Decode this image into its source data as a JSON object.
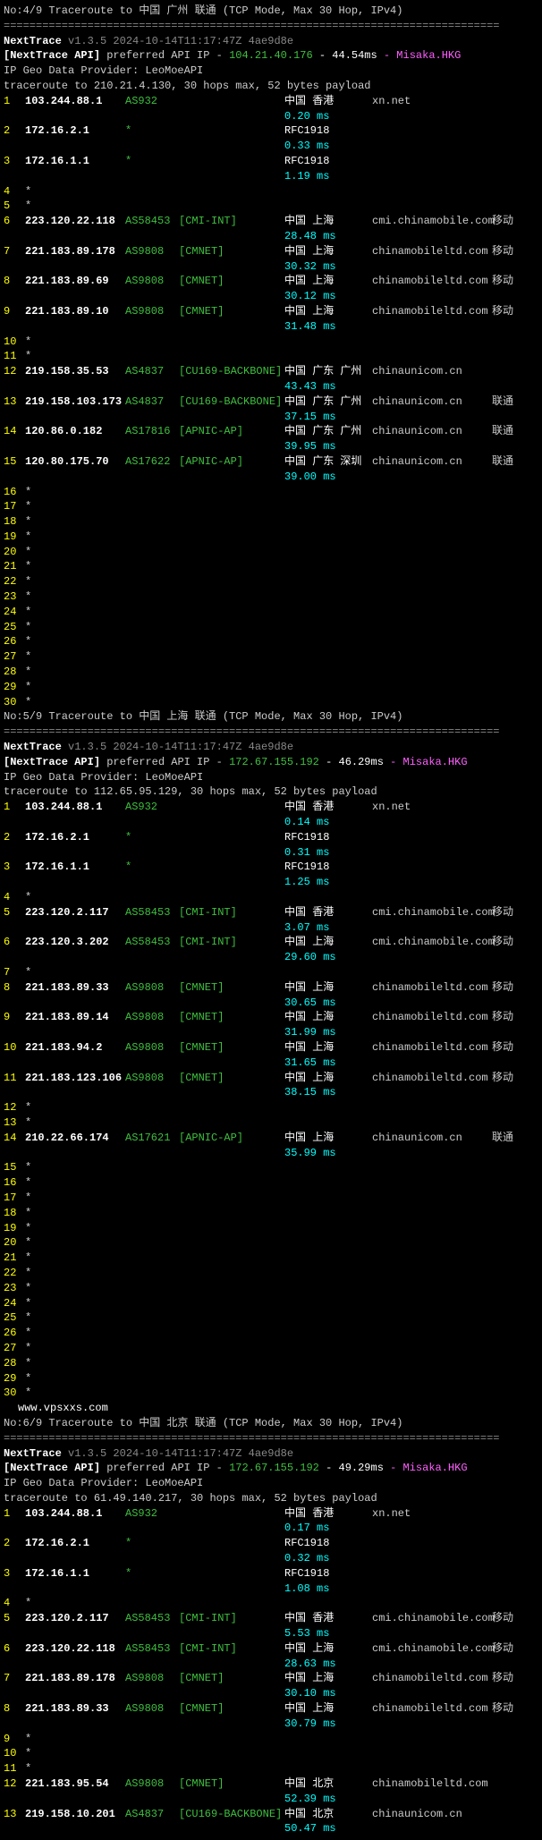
{
  "sections": [
    {
      "header": "No:4/9 Traceroute to 中国 广州 联通 (TCP Mode, Max 30 Hop, IPv4)",
      "nexttrace": "NextTrace",
      "version": "v1.3.5 2024-10-14T11:17:47Z 4ae9d8e",
      "api_label": "[NextTrace API]",
      "api_text": "preferred API IP -",
      "api_ip": "104.21.40.176",
      "api_ms": "- 44.54ms",
      "api_loc": "- Misaka.HKG",
      "geo": "IP Geo Data Provider: LeoMoeAPI",
      "trace": "traceroute to 210.21.4.130, 30 hops max, 52 bytes payload",
      "hops": [
        {
          "n": "1",
          "ip": "103.244.88.1",
          "asn": "AS932",
          "net": "",
          "geo": "中国 香港",
          "host": "xn.net",
          "isp": "",
          "ms": "0.20 ms"
        },
        {
          "n": "2",
          "ip": "172.16.2.1",
          "asn": "*",
          "net": "",
          "geo": "",
          "rfc": "RFC1918",
          "host": "",
          "isp": "",
          "ms": "0.33 ms"
        },
        {
          "n": "3",
          "ip": "172.16.1.1",
          "asn": "*",
          "net": "",
          "geo": "",
          "rfc": "RFC1918",
          "host": "",
          "isp": "",
          "ms": "1.19 ms"
        },
        {
          "n": "4",
          "star": true
        },
        {
          "n": "5",
          "star": true
        },
        {
          "n": "6",
          "ip": "223.120.22.118",
          "asn": "AS58453",
          "net": "[CMI-INT]",
          "geo": "中国 上海",
          "host": "cmi.chinamobile.com",
          "isp": "移动",
          "ms": "28.48 ms"
        },
        {
          "n": "7",
          "ip": "221.183.89.178",
          "asn": "AS9808",
          "net": "[CMNET]",
          "geo": "中国 上海",
          "host": "chinamobileltd.com",
          "isp": "移动",
          "ms": "30.32 ms"
        },
        {
          "n": "8",
          "ip": "221.183.89.69",
          "asn": "AS9808",
          "net": "[CMNET]",
          "geo": "中国 上海",
          "host": "chinamobileltd.com",
          "isp": "移动",
          "ms": "30.12 ms"
        },
        {
          "n": "9",
          "ip": "221.183.89.10",
          "asn": "AS9808",
          "net": "[CMNET]",
          "geo": "中国 上海",
          "host": "chinamobileltd.com",
          "isp": "移动",
          "ms": "31.48 ms"
        },
        {
          "n": "10",
          "star": true
        },
        {
          "n": "11",
          "star": true
        },
        {
          "n": "12",
          "ip": "219.158.35.53",
          "asn": "AS4837",
          "net": "[CU169-BACKBONE]",
          "geo": "中国 广东 广州",
          "host": "chinaunicom.cn",
          "isp": "",
          "ms": "43.43 ms"
        },
        {
          "n": "13",
          "ip": "219.158.103.173",
          "asn": "AS4837",
          "net": "[CU169-BACKBONE]",
          "geo": "中国 广东 广州",
          "host": "chinaunicom.cn",
          "isp": "联通",
          "ms": "37.15 ms"
        },
        {
          "n": "14",
          "ip": "120.86.0.182",
          "asn": "AS17816",
          "net": "[APNIC-AP]",
          "geo": "中国 广东 广州",
          "host": "chinaunicom.cn",
          "isp": "联通",
          "ms": "39.95 ms"
        },
        {
          "n": "15",
          "ip": "120.80.175.70",
          "asn": "AS17622",
          "net": "[APNIC-AP]",
          "geo": "中国 广东 深圳",
          "host": "chinaunicom.cn",
          "isp": "联通",
          "ms": "39.00 ms"
        },
        {
          "n": "16",
          "star": true
        },
        {
          "n": "17",
          "star": true
        },
        {
          "n": "18",
          "star": true
        },
        {
          "n": "19",
          "star": true
        },
        {
          "n": "20",
          "star": true
        },
        {
          "n": "21",
          "star": true
        },
        {
          "n": "22",
          "star": true
        },
        {
          "n": "23",
          "star": true
        },
        {
          "n": "24",
          "star": true
        },
        {
          "n": "25",
          "star": true
        },
        {
          "n": "26",
          "star": true
        },
        {
          "n": "27",
          "star": true
        },
        {
          "n": "28",
          "star": true
        },
        {
          "n": "29",
          "star": true
        },
        {
          "n": "30",
          "star": true
        }
      ]
    },
    {
      "header": "No:5/9 Traceroute to 中国 上海 联通 (TCP Mode, Max 30 Hop, IPv4)",
      "nexttrace": "NextTrace",
      "version": "v1.3.5 2024-10-14T11:17:47Z 4ae9d8e",
      "api_label": "[NextTrace API]",
      "api_text": "preferred API IP -",
      "api_ip": "172.67.155.192",
      "api_ms": "- 46.29ms",
      "api_loc": "- Misaka.HKG",
      "geo": "IP Geo Data Provider: LeoMoeAPI",
      "trace": "traceroute to 112.65.95.129, 30 hops max, 52 bytes payload",
      "hops": [
        {
          "n": "1",
          "ip": "103.244.88.1",
          "asn": "AS932",
          "net": "",
          "geo": "中国 香港",
          "host": "xn.net",
          "isp": "",
          "ms": "0.14 ms"
        },
        {
          "n": "2",
          "ip": "172.16.2.1",
          "asn": "*",
          "net": "",
          "geo": "",
          "rfc": "RFC1918",
          "host": "",
          "isp": "",
          "ms": "0.31 ms"
        },
        {
          "n": "3",
          "ip": "172.16.1.1",
          "asn": "*",
          "net": "",
          "geo": "",
          "rfc": "RFC1918",
          "host": "",
          "isp": "",
          "ms": "1.25 ms"
        },
        {
          "n": "4",
          "star": true
        },
        {
          "n": "5",
          "ip": "223.120.2.117",
          "asn": "AS58453",
          "net": "[CMI-INT]",
          "geo": "中国 香港",
          "host": "cmi.chinamobile.com",
          "isp": "移动",
          "ms": "3.07 ms"
        },
        {
          "n": "6",
          "ip": "223.120.3.202",
          "asn": "AS58453",
          "net": "[CMI-INT]",
          "geo": "中国 上海",
          "host": "cmi.chinamobile.com",
          "isp": "移动",
          "ms": "29.60 ms"
        },
        {
          "n": "7",
          "star": true
        },
        {
          "n": "8",
          "ip": "221.183.89.33",
          "asn": "AS9808",
          "net": "[CMNET]",
          "geo": "中国 上海",
          "host": "chinamobileltd.com",
          "isp": "移动",
          "ms": "30.65 ms"
        },
        {
          "n": "9",
          "ip": "221.183.89.14",
          "asn": "AS9808",
          "net": "[CMNET]",
          "geo": "中国 上海",
          "host": "chinamobileltd.com",
          "isp": "移动",
          "ms": "31.99 ms"
        },
        {
          "n": "10",
          "ip": "221.183.94.2",
          "asn": "AS9808",
          "net": "[CMNET]",
          "geo": "中国 上海",
          "host": "chinamobileltd.com",
          "isp": "移动",
          "ms": "31.65 ms"
        },
        {
          "n": "11",
          "ip": "221.183.123.106",
          "asn": "AS9808",
          "net": "[CMNET]",
          "geo": "中国 上海",
          "host": "chinamobileltd.com",
          "isp": "移动",
          "ms": "38.15 ms"
        },
        {
          "n": "12",
          "star": true
        },
        {
          "n": "13",
          "star": true
        },
        {
          "n": "14",
          "ip": "210.22.66.174",
          "asn": "AS17621",
          "net": "[APNIC-AP]",
          "geo": "中国 上海",
          "host": "chinaunicom.cn",
          "isp": "联通",
          "ms": "35.99 ms"
        },
        {
          "n": "15",
          "star": true
        },
        {
          "n": "16",
          "star": true
        },
        {
          "n": "17",
          "star": true
        },
        {
          "n": "18",
          "star": true
        },
        {
          "n": "19",
          "star": true
        },
        {
          "n": "20",
          "star": true
        },
        {
          "n": "21",
          "star": true
        },
        {
          "n": "22",
          "star": true
        },
        {
          "n": "23",
          "star": true
        },
        {
          "n": "24",
          "star": true
        },
        {
          "n": "25",
          "star": true
        },
        {
          "n": "26",
          "star": true
        },
        {
          "n": "27",
          "star": true
        },
        {
          "n": "28",
          "star": true
        },
        {
          "n": "29",
          "star": true
        },
        {
          "n": "30",
          "star": true
        }
      ],
      "watermark": "www.vpsxxs.com"
    },
    {
      "header": "No:6/9 Traceroute to 中国 北京 联通 (TCP Mode, Max 30 Hop, IPv4)",
      "nexttrace": "NextTrace",
      "version": "v1.3.5 2024-10-14T11:17:47Z 4ae9d8e",
      "api_label": "[NextTrace API]",
      "api_text": "preferred API IP -",
      "api_ip": "172.67.155.192",
      "api_ms": "- 49.29ms",
      "api_loc": "- Misaka.HKG",
      "geo": "IP Geo Data Provider: LeoMoeAPI",
      "trace": "traceroute to 61.49.140.217, 30 hops max, 52 bytes payload",
      "hops": [
        {
          "n": "1",
          "ip": "103.244.88.1",
          "asn": "AS932",
          "net": "",
          "geo": "中国 香港",
          "host": "xn.net",
          "isp": "",
          "ms": "0.17 ms"
        },
        {
          "n": "2",
          "ip": "172.16.2.1",
          "asn": "*",
          "net": "",
          "geo": "",
          "rfc": "RFC1918",
          "host": "",
          "isp": "",
          "ms": "0.32 ms"
        },
        {
          "n": "3",
          "ip": "172.16.1.1",
          "asn": "*",
          "net": "",
          "geo": "",
          "rfc": "RFC1918",
          "host": "",
          "isp": "",
          "ms": "1.08 ms"
        },
        {
          "n": "4",
          "star": true
        },
        {
          "n": "5",
          "ip": "223.120.2.117",
          "asn": "AS58453",
          "net": "[CMI-INT]",
          "geo": "中国 香港",
          "host": "cmi.chinamobile.com",
          "isp": "移动",
          "ms": "5.53 ms"
        },
        {
          "n": "6",
          "ip": "223.120.22.118",
          "asn": "AS58453",
          "net": "[CMI-INT]",
          "geo": "中国 上海",
          "host": "cmi.chinamobile.com",
          "isp": "移动",
          "ms": "28.63 ms"
        },
        {
          "n": "7",
          "ip": "221.183.89.178",
          "asn": "AS9808",
          "net": "[CMNET]",
          "geo": "中国 上海",
          "host": "chinamobileltd.com",
          "isp": "移动",
          "ms": "30.10 ms"
        },
        {
          "n": "8",
          "ip": "221.183.89.33",
          "asn": "AS9808",
          "net": "[CMNET]",
          "geo": "中国 上海",
          "host": "chinamobileltd.com",
          "isp": "移动",
          "ms": "30.79 ms"
        },
        {
          "n": "9",
          "star": true
        },
        {
          "n": "10",
          "star": true
        },
        {
          "n": "11",
          "star": true
        },
        {
          "n": "12",
          "ip": "221.183.95.54",
          "asn": "AS9808",
          "net": "[CMNET]",
          "geo": "中国 北京",
          "host": "chinamobileltd.com",
          "isp": "",
          "ms": "52.39 ms"
        },
        {
          "n": "13",
          "ip": "219.158.10.201",
          "asn": "AS4837",
          "net": "[CU169-BACKBONE]",
          "geo": "中国 北京",
          "host": "chinaunicom.cn",
          "isp": "",
          "ms": "50.47 ms"
        }
      ]
    }
  ],
  "divider": "============================================================================="
}
